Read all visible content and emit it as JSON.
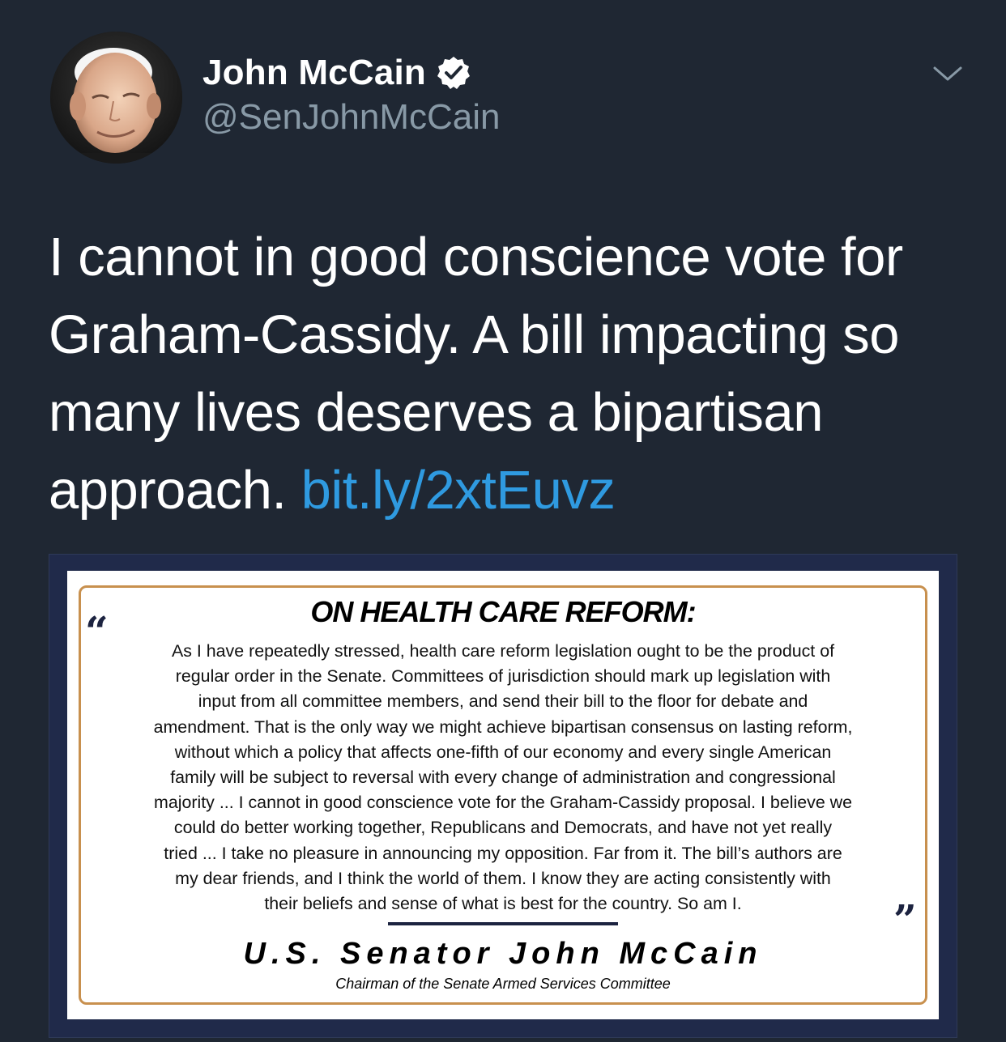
{
  "author": {
    "name": "John McCain",
    "handle": "@SenJohnMcCain",
    "verified": true,
    "avatar": "portrait photo of John McCain"
  },
  "tweet": {
    "text_lines": [
      "I cannot in good conscience vote for",
      "Graham-Cassidy. A bill impacting so",
      "many lives deserves a bipartisan"
    ],
    "last_line_text": "approach.",
    "link_text": "bit.ly/2xtEuvz"
  },
  "media_card": {
    "title": "ON HEALTH CARE REFORM:",
    "quote_open": "“",
    "quote_close": "”",
    "body_lines": [
      "As I have repeatedly stressed, health care reform legislation ought to be the product of",
      "regular order in the Senate. Committees of jurisdiction should mark up legislation with",
      "input from all committee members, and send their bill to the floor for debate and",
      "amendment. That is the only way we might achieve bipartisan consensus on lasting reform,",
      "without which a policy that affects one-fifth of our economy and every single American",
      "family will be subject to reversal with every change of administration and congressional",
      "majority ... I cannot in good conscience vote for the Graham-Cassidy proposal. I believe we",
      "could do better working together, Republicans and Democrats, and have not yet really",
      "tried ... I take no pleasure in announcing my opposition. Far from it. The bill’s authors are",
      "my dear friends, and I think the world of them. I know they are acting consistently with",
      "their beliefs and sense of what is best for the country. So am I."
    ],
    "signature": "U.S. Senator John McCain",
    "signature_title": "Chairman of the Senate Armed Services Committee"
  },
  "colors": {
    "background": "#1f2733",
    "link": "#2f9ae0",
    "handle": "#8899a6",
    "frame_border": "#c8904e",
    "card_background": "#202a4a"
  },
  "icons": {
    "verified": "verified-badge-icon",
    "menu": "chevron-down-icon"
  }
}
